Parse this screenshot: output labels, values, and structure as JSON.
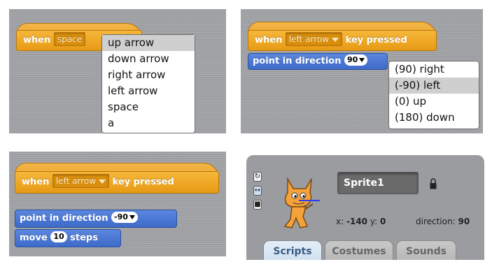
{
  "panel1": {
    "hat": {
      "prefix": "when",
      "key": "space"
    },
    "menu": [
      "up arrow",
      "down arrow",
      "right arrow",
      "left arrow",
      "space",
      "a"
    ],
    "selected_index": 0
  },
  "panel2": {
    "hat": {
      "prefix": "when",
      "key": "left arrow",
      "suffix": "key pressed"
    },
    "block": {
      "label": "point in direction",
      "value": "90"
    },
    "menu": [
      "(90) right",
      "(-90) left",
      "(0) up",
      "(180) down"
    ],
    "selected_index": 1
  },
  "panel3": {
    "hat": {
      "prefix": "when",
      "key": "left arrow",
      "suffix": "key pressed"
    },
    "block1": {
      "label": "point in direction",
      "value": "-90"
    },
    "block2": {
      "prefix": "move",
      "value": "10",
      "suffix": "steps"
    }
  },
  "panel4": {
    "sprite_name": "Sprite1",
    "x_label": "x:",
    "x_value": "-140",
    "y_label": "y:",
    "y_value": "0",
    "direction_label": "direction:",
    "direction_value": "90",
    "tabs": [
      "Scripts",
      "Costumes",
      "Sounds"
    ],
    "active_tab": 0,
    "icons": [
      "rotate-icon",
      "left-right-icon",
      "dont-rotate-icon",
      "cat-sprite-icon",
      "lock-icon"
    ]
  },
  "colors": {
    "events": "#e79a14",
    "motion": "#4a73d0",
    "stage": "#9c9ea2"
  }
}
